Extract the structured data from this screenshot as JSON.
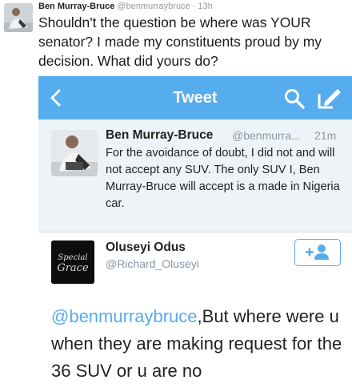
{
  "outer_tweet": {
    "name": "Ben Murray-Bruce",
    "handle": "@benmurraybruce",
    "separator": "·",
    "time": "13h",
    "text": "Shouldn't the question be where was YOUR senator? I made my constituents proud by my decision. What did yours do?"
  },
  "phone_screen": {
    "navbar": {
      "title": "Tweet",
      "back_icon": "chevron-left-icon",
      "search_icon": "search-icon",
      "compose_icon": "compose-icon",
      "color": "#55acee"
    },
    "quoted_tweet": {
      "name": "Ben Murray-Bruce",
      "handle": "@benmurra...",
      "time": "21m",
      "text": "For the avoidance of doubt, I did not and will not accept any SUV. The only SUV I, Ben Murray-Bruce will accept is a made in Nigeria car."
    },
    "main_tweet": {
      "name": "Oluseyi Odus",
      "handle": "@Richard_Oluseyi",
      "avatar_text": "Special Grace",
      "follow_icon": "add-user-icon",
      "mention": "@benmurraybruce",
      "text": ",But where were u when they are making request for the 36 SUV or u are no"
    }
  }
}
